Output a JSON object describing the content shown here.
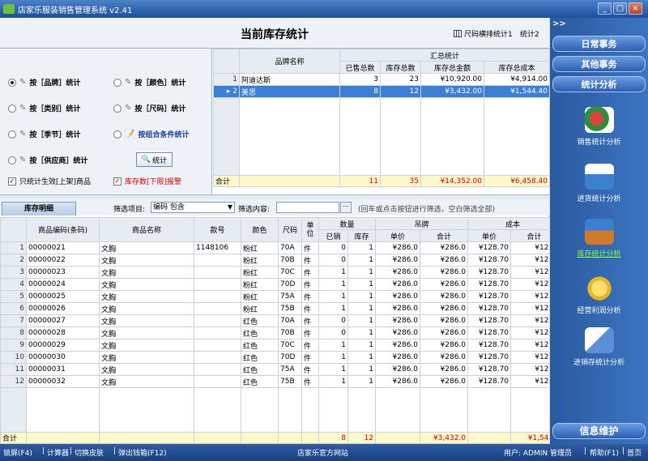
{
  "window": {
    "title": "店家乐服装销售管理系统 v2.41",
    "min": "_",
    "max": "□",
    "close": "×"
  },
  "page": {
    "title": "当前库存统计",
    "opt1": "尺码横排统计1",
    "opt2": "统计2"
  },
  "options": {
    "items": [
      {
        "label": "按［品牌］统计",
        "selected": true
      },
      {
        "label": "按［颜色］统计",
        "selected": false
      },
      {
        "label": "按［类别］统计",
        "selected": false
      },
      {
        "label": "按［尺码］统计",
        "selected": false
      },
      {
        "label": "按［季节］统计",
        "selected": false
      },
      {
        "label": "按组合条件统计",
        "selected": false
      },
      {
        "label": "按［供应商］统计",
        "selected": false
      }
    ],
    "stat_button": "统计",
    "check1": "只统计生效[上架]商品",
    "check2": "库存数[下限]报警"
  },
  "summary": {
    "group_header": "汇总统计",
    "headers": [
      "品牌名称",
      "已售总数",
      "库存总数",
      "库存总金额",
      "库存总成本"
    ],
    "rows": [
      {
        "idx": "1",
        "brand": "阿迪达斯",
        "sold": "3",
        "stock": "23",
        "amount": "¥10,920.00",
        "cost": "¥4,914.00"
      },
      {
        "idx": "2",
        "brand": "美思",
        "sold": "8",
        "stock": "12",
        "amount": "¥3,432.00",
        "cost": "¥1,544.40"
      }
    ],
    "total": {
      "label": "合计",
      "sold": "11",
      "stock": "35",
      "amount": "¥14,352.00",
      "cost": "¥6,458.40"
    }
  },
  "detail_bar": {
    "tab": "库存明细",
    "filter_label": "筛选项目:",
    "filter_value": "编码 包含",
    "content_label": "筛选内容:",
    "hint": "(回车或点击按钮进行筛选，空白筛选全部)"
  },
  "detail": {
    "headers": {
      "code": "商品编码(条码)",
      "name": "商品名称",
      "model": "款号",
      "color": "颜色",
      "size": "尺码",
      "unit": "单位",
      "qty": "数量",
      "sold": "已销",
      "stock": "库存",
      "tag": "吊牌",
      "price": "单价",
      "sum": "合计",
      "cost": "成本",
      "cprice": "单价",
      "csum": "合计"
    },
    "rows": [
      {
        "i": "1",
        "code": "00000021",
        "name": "文胸",
        "model": "1148106",
        "color": "粉红",
        "size": "70A",
        "unit": "件",
        "sold": "0",
        "stock": "1",
        "price": "¥286.0",
        "sum": "¥286.0",
        "cprice": "¥128.70",
        "csum": "¥128."
      },
      {
        "i": "2",
        "code": "00000022",
        "name": "文胸",
        "model": "",
        "color": "粉红",
        "size": "70B",
        "unit": "件",
        "sold": "0",
        "stock": "1",
        "price": "¥286.0",
        "sum": "¥286.0",
        "cprice": "¥128.70",
        "csum": "¥128."
      },
      {
        "i": "3",
        "code": "00000023",
        "name": "文胸",
        "model": "",
        "color": "粉红",
        "size": "70C",
        "unit": "件",
        "sold": "1",
        "stock": "1",
        "price": "¥286.0",
        "sum": "¥286.0",
        "cprice": "¥128.70",
        "csum": "¥128."
      },
      {
        "i": "4",
        "code": "00000024",
        "name": "文胸",
        "model": "",
        "color": "粉红",
        "size": "70D",
        "unit": "件",
        "sold": "1",
        "stock": "1",
        "price": "¥286.0",
        "sum": "¥286.0",
        "cprice": "¥128.70",
        "csum": "¥128."
      },
      {
        "i": "5",
        "code": "00000025",
        "name": "文胸",
        "model": "",
        "color": "粉红",
        "size": "75A",
        "unit": "件",
        "sold": "1",
        "stock": "1",
        "price": "¥286.0",
        "sum": "¥286.0",
        "cprice": "¥128.70",
        "csum": "¥128."
      },
      {
        "i": "6",
        "code": "00000026",
        "name": "文胸",
        "model": "",
        "color": "粉红",
        "size": "75B",
        "unit": "件",
        "sold": "1",
        "stock": "1",
        "price": "¥286.0",
        "sum": "¥286.0",
        "cprice": "¥128.70",
        "csum": "¥128."
      },
      {
        "i": "7",
        "code": "00000027",
        "name": "文胸",
        "model": "",
        "color": "红色",
        "size": "70A",
        "unit": "件",
        "sold": "0",
        "stock": "1",
        "price": "¥286.0",
        "sum": "¥286.0",
        "cprice": "¥128.70",
        "csum": "¥128."
      },
      {
        "i": "8",
        "code": "00000028",
        "name": "文胸",
        "model": "",
        "color": "红色",
        "size": "70B",
        "unit": "件",
        "sold": "0",
        "stock": "1",
        "price": "¥286.0",
        "sum": "¥286.0",
        "cprice": "¥128.70",
        "csum": "¥128."
      },
      {
        "i": "9",
        "code": "00000029",
        "name": "文胸",
        "model": "",
        "color": "红色",
        "size": "70C",
        "unit": "件",
        "sold": "1",
        "stock": "1",
        "price": "¥286.0",
        "sum": "¥286.0",
        "cprice": "¥128.70",
        "csum": "¥128."
      },
      {
        "i": "10",
        "code": "00000030",
        "name": "文胸",
        "model": "",
        "color": "红色",
        "size": "70D",
        "unit": "件",
        "sold": "1",
        "stock": "1",
        "price": "¥286.0",
        "sum": "¥286.0",
        "cprice": "¥128.70",
        "csum": "¥128."
      },
      {
        "i": "11",
        "code": "00000031",
        "name": "文胸",
        "model": "",
        "color": "红色",
        "size": "75A",
        "unit": "件",
        "sold": "1",
        "stock": "1",
        "price": "¥286.0",
        "sum": "¥286.0",
        "cprice": "¥128.70",
        "csum": "¥128."
      },
      {
        "i": "12",
        "code": "00000032",
        "name": "文胸",
        "model": "",
        "color": "红色",
        "size": "75B",
        "unit": "件",
        "sold": "1",
        "stock": "1",
        "price": "¥286.0",
        "sum": "¥286.0",
        "cprice": "¥128.70",
        "csum": "¥128."
      }
    ],
    "total": {
      "label": "合计",
      "sold": "8",
      "stock": "12",
      "sum": "¥3,432.0",
      "csum": "¥1,544."
    }
  },
  "sidebar": {
    "arrow": ">>",
    "buttons": [
      "日常事务",
      "其他事务",
      "统计分析"
    ],
    "items": [
      {
        "label": "销售统计分析",
        "icon": "pie-chart-icon",
        "color": "#2f8f3a"
      },
      {
        "label": "进货统计分析",
        "icon": "house-arrow-icon",
        "color": "#3a7fd0"
      },
      {
        "label": "库存统计分析",
        "icon": "warehouse-icon",
        "color": "#d07a2a",
        "active": true
      },
      {
        "label": "经营利润分析",
        "icon": "coins-icon",
        "color": "#e8b820"
      },
      {
        "label": "进销存统计分析",
        "icon": "chart-line-icon",
        "color": "#5a8fd8"
      }
    ],
    "bottom_button": "信息维护"
  },
  "statusbar": {
    "lock": "锁屏(F4)",
    "calc": "计算器",
    "skin": "切换皮肤",
    "drawer": "弹出钱箱(F12)",
    "site": "店家乐官方网站",
    "user": "用户: ADMIN 管理员",
    "help": "帮助(F1)",
    "home": "首页"
  }
}
